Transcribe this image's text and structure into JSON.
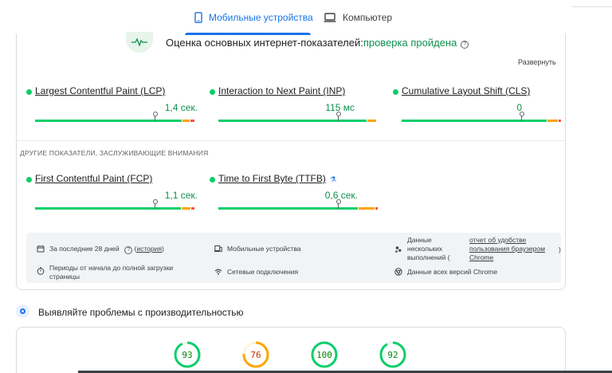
{
  "tabs": {
    "mobile_label": "Мобильные устройства",
    "desktop_label": "Компьютер"
  },
  "cwv": {
    "title": "Оценка основных интернет-показателей:",
    "status": "проверка пройдена",
    "expand_label": "Развернуть"
  },
  "metrics": [
    {
      "name": "Largest Contentful Paint (LCP)",
      "value": "1,4 сек."
    },
    {
      "name": "Interaction to Next Paint (INP)",
      "value": "115 мс"
    },
    {
      "name": "Cumulative Layout Shift (CLS)",
      "value": "0"
    }
  ],
  "other": {
    "title": "ДРУГИЕ ПОКАЗАТЕЛИ, ЗАСЛУЖИВАЮЩИЕ ВНИМАНИЯ",
    "metrics": [
      {
        "name": "First Contentful Paint (FCP)",
        "value": "1,1 сек."
      },
      {
        "name": "Time to First Byte (TTFB)",
        "value": "0,6 сек."
      }
    ]
  },
  "info": {
    "period_prefix": "За последние 28 дней",
    "history_link": "история",
    "page_loads": "Периоды от начала до полной загрузки страницы",
    "devices": "Мобильные устройства",
    "connections": "Сетевые подключения",
    "data_prefix": "Данные нескольких выполнений (",
    "crux_link": "отчет об удобстве пользования браузером Chrome",
    "data_suffix": ")",
    "chrome_versions": "Данные всех версий Chrome"
  },
  "diagnose": {
    "title": "Выявляйте проблемы с производительностью"
  },
  "scores": [
    {
      "value": 93,
      "label": "93",
      "color": "#0cce6b"
    },
    {
      "value": 76,
      "label": "76",
      "color": "#ffa400"
    },
    {
      "value": 100,
      "label": "100",
      "color": "#0cce6b"
    },
    {
      "value": 92,
      "label": "92",
      "color": "#0cce6b"
    }
  ],
  "colors": {
    "good": "#0cce6b",
    "average": "#ffa400",
    "poor": "#ff4e42",
    "accent": "#1a73e8",
    "pass_text": "#0d904f"
  }
}
